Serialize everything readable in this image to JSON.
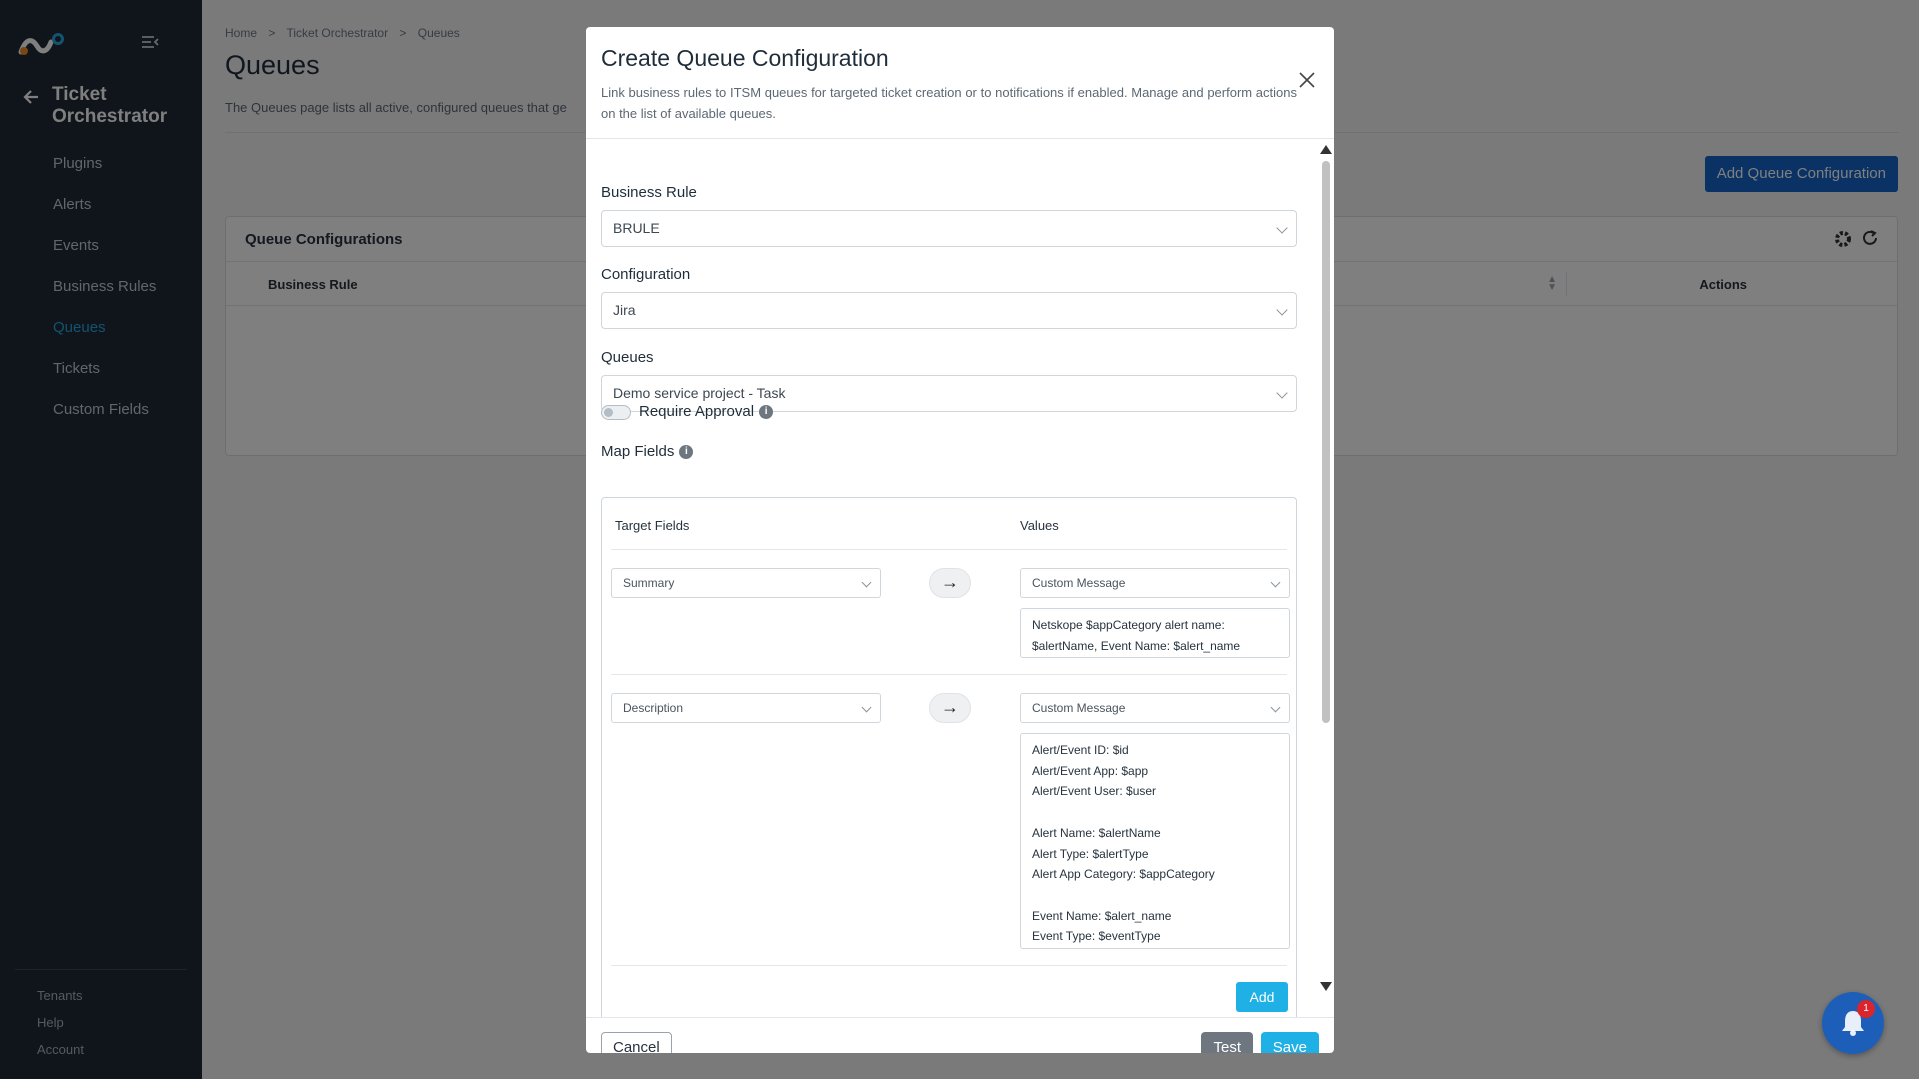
{
  "sidebar": {
    "app_title": "Ticket Orchestrator",
    "items": [
      {
        "label": "Plugins"
      },
      {
        "label": "Alerts"
      },
      {
        "label": "Events"
      },
      {
        "label": "Business Rules"
      },
      {
        "label": "Queues",
        "active": true
      },
      {
        "label": "Tickets"
      },
      {
        "label": "Custom Fields"
      }
    ],
    "bottom_items": [
      {
        "label": "Tenants"
      },
      {
        "label": "Help"
      },
      {
        "label": "Account"
      }
    ],
    "active_color": "#27a7e0"
  },
  "main": {
    "breadcrumb": [
      "Home",
      ">",
      "Ticket Orchestrator",
      ">",
      "Queues"
    ],
    "title": "Queues",
    "description": "The Queues page lists all active, configured queues that ge",
    "add_button": "Add Queue Configuration",
    "card_title": "Queue Configurations",
    "columns": {
      "business_rule": "Business Rule",
      "actions": "Actions"
    }
  },
  "modal": {
    "title": "Create Queue Configuration",
    "description": "Link business rules to ITSM queues for targeted ticket creation or to notifications if enabled. Manage and perform actions on the list of available queues.",
    "business_rule": {
      "label": "Business Rule",
      "value": "BRULE"
    },
    "configuration": {
      "label": "Configuration",
      "value": "Jira"
    },
    "queues": {
      "label": "Queues",
      "value": "Demo service project - Task"
    },
    "require_approval": {
      "label": "Require Approval",
      "enabled": false
    },
    "map_fields": {
      "label": "Map Fields",
      "target_header": "Target Fields",
      "values_header": "Values",
      "rows": [
        {
          "target": "Summary",
          "value_type": "Custom Message",
          "message": "Netskope $appCategory alert name: $alertName, Event Name: $alert_name"
        },
        {
          "target": "Description",
          "value_type": "Custom Message",
          "message": "Alert/Event ID: $id\nAlert/Event App: $app\nAlert/Event User: $user\n\nAlert Name: $alertName\nAlert Type: $alertType\nAlert App Category: $appCategory\n\nEvent Name: $alert_name\nEvent Type: $eventType"
        }
      ],
      "add_button": "Add"
    },
    "cancel_button": "Cancel",
    "test_button": "Test",
    "save_button": "Save"
  },
  "notifications": {
    "badge_count": "1"
  }
}
